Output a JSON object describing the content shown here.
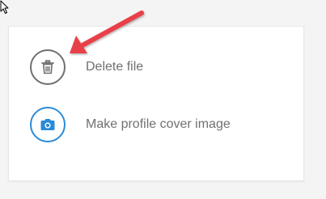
{
  "menu": {
    "items": [
      {
        "label": "Delete file",
        "icon": "trash-icon",
        "icon_color": "#707070"
      },
      {
        "label": "Make profile cover image",
        "icon": "camera-icon",
        "icon_color": "#2b8ad8"
      }
    ]
  },
  "annotation": {
    "arrow_color": "#e8404a",
    "arrow_points_to": "trash-icon"
  }
}
